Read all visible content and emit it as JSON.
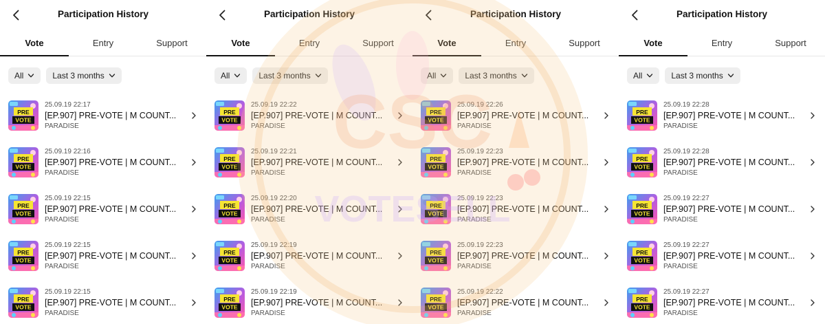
{
  "panels": [
    {
      "header": {
        "title": "Participation History"
      },
      "tabs": {
        "vote": "Vote",
        "entry": "Entry",
        "support": "Support"
      },
      "filters": {
        "all": "All",
        "period": "Last 3 months"
      },
      "items": [
        {
          "time": "25.09.19 22:17",
          "name": "[EP.907] PRE-VOTE | M COUNT...",
          "artist": "PARADISE"
        },
        {
          "time": "25.09.19 22:16",
          "name": "[EP.907] PRE-VOTE | M COUNT...",
          "artist": "PARADISE"
        },
        {
          "time": "25.09.19 22:15",
          "name": "[EP.907] PRE-VOTE | M COUNT...",
          "artist": "PARADISE"
        },
        {
          "time": "25.09.19 22:15",
          "name": "[EP.907] PRE-VOTE | M COUNT...",
          "artist": "PARADISE"
        },
        {
          "time": "25.09.19 22:15",
          "name": "[EP.907] PRE-VOTE | M COUNT...",
          "artist": "PARADISE"
        }
      ]
    },
    {
      "header": {
        "title": "Participation History"
      },
      "tabs": {
        "vote": "Vote",
        "entry": "Entry",
        "support": "Support"
      },
      "filters": {
        "all": "All",
        "period": "Last 3 months"
      },
      "items": [
        {
          "time": "25.09.19 22:22",
          "name": "[EP.907] PRE-VOTE | M COUNT...",
          "artist": "PARADISE"
        },
        {
          "time": "25.09.19 22:21",
          "name": "[EP.907] PRE-VOTE | M COUNT...",
          "artist": "PARADISE"
        },
        {
          "time": "25.09.19 22:20",
          "name": "[EP.907] PRE-VOTE | M COUNT...",
          "artist": "PARADISE"
        },
        {
          "time": "25.09.19 22:19",
          "name": "[EP.907] PRE-VOTE | M COUNT...",
          "artist": "PARADISE"
        },
        {
          "time": "25.09.19 22:19",
          "name": "[EP.907] PRE-VOTE | M COUNT...",
          "artist": "PARADISE"
        }
      ]
    },
    {
      "header": {
        "title": "Participation History"
      },
      "tabs": {
        "vote": "Vote",
        "entry": "Entry",
        "support": "Support"
      },
      "filters": {
        "all": "All",
        "period": "Last 3 months"
      },
      "items": [
        {
          "time": "25.09.19 22:26",
          "name": "[EP.907] PRE-VOTE | M COUNT...",
          "artist": "PARADISE"
        },
        {
          "time": "25.09.19 22:23",
          "name": "[EP.907] PRE-VOTE | M COUNT...",
          "artist": "PARADISE"
        },
        {
          "time": "25.09.19 22:23",
          "name": "[EP.907] PRE-VOTE | M COUNT...",
          "artist": "PARADISE"
        },
        {
          "time": "25.09.19 22:23",
          "name": "[EP.907] PRE-VOTE | M COUNT...",
          "artist": "PARADISE"
        },
        {
          "time": "25.09.19 22:22",
          "name": "[EP.907] PRE-VOTE | M COUNT...",
          "artist": "PARADISE"
        }
      ]
    },
    {
      "header": {
        "title": "Participation History"
      },
      "tabs": {
        "vote": "Vote",
        "entry": "Entry",
        "support": "Support"
      },
      "filters": {
        "all": "All",
        "period": "Last 3 months"
      },
      "items": [
        {
          "time": "25.09.19 22:28",
          "name": "[EP.907] PRE-VOTE | M COUNT...",
          "artist": "PARADISE"
        },
        {
          "time": "25.09.19 22:28",
          "name": "[EP.907] PRE-VOTE | M COUNT...",
          "artist": "PARADISE"
        },
        {
          "time": "25.09.19 22:27",
          "name": "[EP.907] PRE-VOTE | M COUNT...",
          "artist": "PARADISE"
        },
        {
          "time": "25.09.19 22:27",
          "name": "[EP.907] PRE-VOTE | M COUNT...",
          "artist": "PARADISE"
        },
        {
          "time": "25.09.19 22:27",
          "name": "[EP.907] PRE-VOTE | M COUNT...",
          "artist": "PARADISE"
        }
      ]
    }
  ],
  "thumbnail": {
    "line1": "PRE",
    "line2": "VOTE",
    "icon": "pre-vote-thumbnail-icon"
  },
  "watermark": {
    "logo": "CSC",
    "text": "VOTESELL"
  },
  "colors": {
    "active_tab_underline": "#111111",
    "chip_background": "#eeeeee",
    "thumb_blue": "#2f8fe0",
    "thumb_pink": "#ff4fa0",
    "thumb_yellow": "#f6e533",
    "thumb_purple": "#7a3fd6",
    "watermark_orange": "#f3b36a"
  }
}
